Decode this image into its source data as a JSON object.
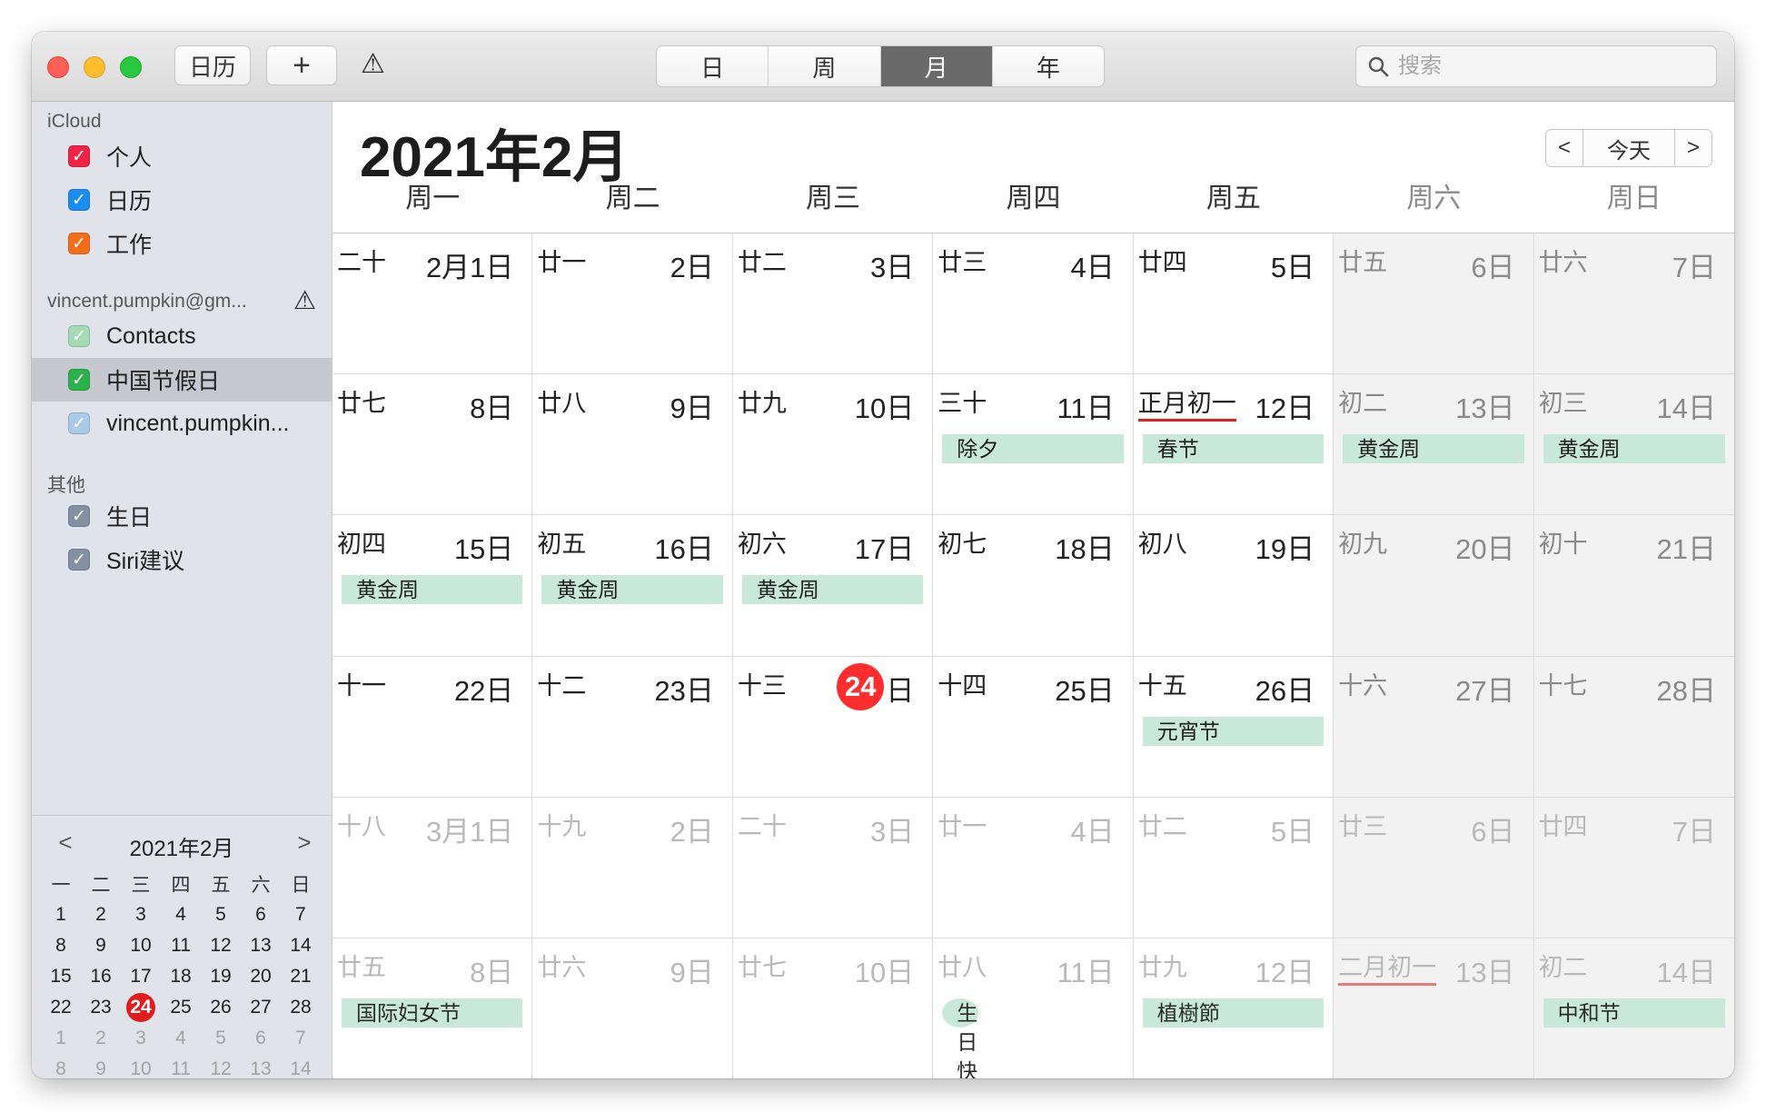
{
  "toolbar": {
    "calendars_label": "日历",
    "add_label": "+",
    "alert_icon": "⚠",
    "view_tabs": [
      "日",
      "周",
      "月",
      "年"
    ],
    "active_tab": "月",
    "search_placeholder": "搜索"
  },
  "sidebar": {
    "groups": [
      {
        "header": "iCloud",
        "items": [
          {
            "label": "个人",
            "color": "#ee2346"
          },
          {
            "label": "日历",
            "color": "#1b8cf0"
          },
          {
            "label": "工作",
            "color": "#f46e19"
          }
        ]
      },
      {
        "header": "vincent.pumpkin@gm...",
        "items": [
          {
            "label": "Contacts",
            "color": "#a5dbb4"
          },
          {
            "label": "中国节假日",
            "color": "#2db14b",
            "selected": true
          },
          {
            "label": "vincent.pumpkin...",
            "color": "#a9cbe8"
          }
        ]
      },
      {
        "header": "其他",
        "items": [
          {
            "label": "生日",
            "color": "#8390a3"
          },
          {
            "label": "Siri建议",
            "color": "#8390a3"
          }
        ]
      }
    ]
  },
  "mini_calendar": {
    "title": "2021年2月",
    "prev": "<",
    "next": ">",
    "weekday_headers": [
      "一",
      "二",
      "三",
      "四",
      "五",
      "六",
      "日"
    ],
    "weeks": [
      [
        "1",
        "2",
        "3",
        "4",
        "5",
        "6",
        "7"
      ],
      [
        "8",
        "9",
        "10",
        "11",
        "12",
        "13",
        "14"
      ],
      [
        "15",
        "16",
        "17",
        "18",
        "19",
        "20",
        "21"
      ],
      [
        "22",
        "23",
        "24",
        "25",
        "26",
        "27",
        "28"
      ],
      [
        "1",
        "2",
        "3",
        "4",
        "5",
        "6",
        "7"
      ],
      [
        "8",
        "9",
        "10",
        "11",
        "12",
        "13",
        "14"
      ]
    ],
    "today": "24"
  },
  "main": {
    "title": "2021年2月",
    "nav_prev": "<",
    "today_label": "今天",
    "nav_next": ">",
    "weekdays": [
      "周一",
      "周二",
      "周三",
      "周四",
      "周五",
      "周六",
      "周日"
    ],
    "weeks": [
      [
        {
          "lunar": "二十",
          "date": "2月1日"
        },
        {
          "lunar": "廿一",
          "date": "2日"
        },
        {
          "lunar": "廿二",
          "date": "3日"
        },
        {
          "lunar": "廿三",
          "date": "4日"
        },
        {
          "lunar": "廿四",
          "date": "5日"
        },
        {
          "lunar": "廿五",
          "date": "6日"
        },
        {
          "lunar": "廿六",
          "date": "7日"
        }
      ],
      [
        {
          "lunar": "廿七",
          "date": "8日"
        },
        {
          "lunar": "廿八",
          "date": "9日"
        },
        {
          "lunar": "廿九",
          "date": "10日"
        },
        {
          "lunar": "三十",
          "date": "11日",
          "event": "除夕"
        },
        {
          "lunar": "正月初一",
          "date": "12日",
          "event": "春节",
          "underline": true
        },
        {
          "lunar": "初二",
          "date": "13日",
          "event": "黄金周"
        },
        {
          "lunar": "初三",
          "date": "14日",
          "event": "黄金周"
        }
      ],
      [
        {
          "lunar": "初四",
          "date": "15日",
          "event": "黄金周"
        },
        {
          "lunar": "初五",
          "date": "16日",
          "event": "黄金周"
        },
        {
          "lunar": "初六",
          "date": "17日",
          "event": "黄金周"
        },
        {
          "lunar": "初七",
          "date": "18日"
        },
        {
          "lunar": "初八",
          "date": "19日"
        },
        {
          "lunar": "初九",
          "date": "20日"
        },
        {
          "lunar": "初十",
          "date": "21日"
        }
      ],
      [
        {
          "lunar": "十一",
          "date": "22日"
        },
        {
          "lunar": "十二",
          "date": "23日"
        },
        {
          "lunar": "十三",
          "date": "日",
          "today_num": "24"
        },
        {
          "lunar": "十四",
          "date": "25日"
        },
        {
          "lunar": "十五",
          "date": "26日",
          "event": "元宵节"
        },
        {
          "lunar": "十六",
          "date": "27日"
        },
        {
          "lunar": "十七",
          "date": "28日"
        }
      ],
      [
        {
          "lunar": "十八",
          "date": "3月1日",
          "dim": true
        },
        {
          "lunar": "十九",
          "date": "2日",
          "dim": true
        },
        {
          "lunar": "二十",
          "date": "3日",
          "dim": true
        },
        {
          "lunar": "廿一",
          "date": "4日",
          "dim": true
        },
        {
          "lunar": "廿二",
          "date": "5日",
          "dim": true
        },
        {
          "lunar": "廿三",
          "date": "6日",
          "dim": true
        },
        {
          "lunar": "廿四",
          "date": "7日",
          "dim": true
        }
      ],
      [
        {
          "lunar": "廿五",
          "date": "8日",
          "dim": true,
          "event": "国际妇女节"
        },
        {
          "lunar": "廿六",
          "date": "9日",
          "dim": true
        },
        {
          "lunar": "廿七",
          "date": "10日",
          "dim": true
        },
        {
          "lunar": "廿八",
          "date": "11日",
          "dim": true,
          "event": "生日快乐!",
          "light": true
        },
        {
          "lunar": "廿九",
          "date": "12日",
          "dim": true,
          "event": "植樹節"
        },
        {
          "lunar": "二月初一",
          "date": "13日",
          "dim": true,
          "underline": true
        },
        {
          "lunar": "初二",
          "date": "14日",
          "dim": true,
          "event": "中和节"
        }
      ]
    ]
  }
}
